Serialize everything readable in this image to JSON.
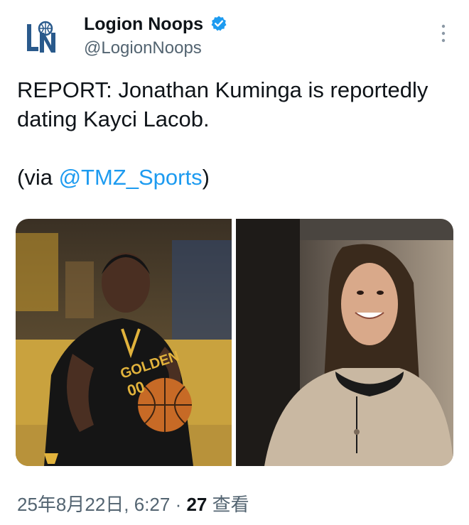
{
  "author": {
    "display_name": "Logion Noops",
    "handle": "@LogionNoops",
    "avatar_icon": "ln-logo-icon",
    "verified": true,
    "verified_color": "#1d9bf0"
  },
  "tweet": {
    "line1": "REPORT: Jonathan Kuminga is reportedly",
    "line2": "dating Kayci Lacob.",
    "via_prefix": "(via ",
    "via_mention": "@TMZ_Sports",
    "via_suffix": ")"
  },
  "media": {
    "left_image": "basketball-player-photo",
    "right_image": "smiling-woman-photo"
  },
  "meta": {
    "timestamp": "25年8月22日, 6:27",
    "separator": " · ",
    "views_count": "27",
    "views_label": " 查看"
  },
  "colors": {
    "accent": "#1d9bf0",
    "text": "#0f1419",
    "secondary": "#536471"
  }
}
